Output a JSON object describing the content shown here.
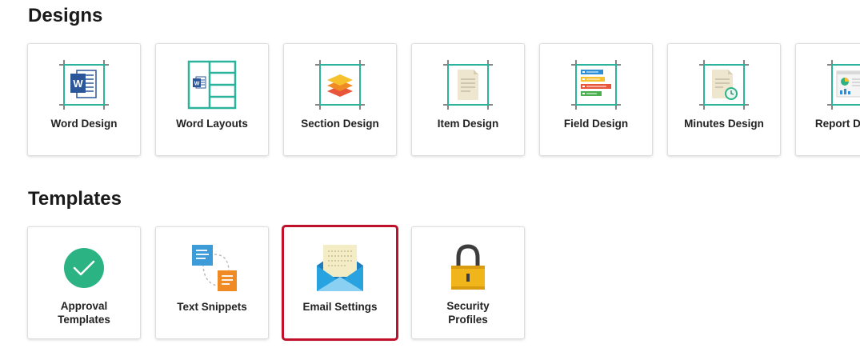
{
  "sections": {
    "designs": {
      "title": "Designs",
      "items": [
        {
          "label": "Word Design",
          "icon": "word-document-icon"
        },
        {
          "label": "Word Layouts",
          "icon": "word-layout-grid-icon"
        },
        {
          "label": "Section Design",
          "icon": "layers-stack-icon"
        },
        {
          "label": "Item Design",
          "icon": "document-page-icon"
        },
        {
          "label": "Field Design",
          "icon": "field-bars-icon"
        },
        {
          "label": "Minutes Design",
          "icon": "document-clock-icon"
        },
        {
          "label": "Report Design",
          "icon": "report-chart-icon"
        }
      ]
    },
    "templates": {
      "title": "Templates",
      "items": [
        {
          "label_line1": "Approval",
          "label_line2": "Templates",
          "icon": "checkmark-circle-icon"
        },
        {
          "label": "Text Snippets",
          "icon": "text-snippets-icon"
        },
        {
          "label": "Email Settings",
          "icon": "envelope-letter-icon",
          "selected": true
        },
        {
          "label_line1": "Security",
          "label_line2": "Profiles",
          "icon": "padlock-icon"
        }
      ]
    }
  },
  "colors": {
    "frame_teal": "#2bb39b",
    "word_blue": "#2b579a",
    "selected_outline": "#c0102a",
    "check_green": "#2bb384",
    "lock_yellow": "#f1b51c",
    "envelope_blue": "#29a3e0"
  }
}
